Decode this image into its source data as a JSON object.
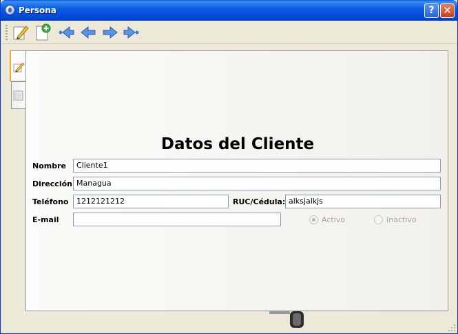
{
  "window": {
    "title": "Persona",
    "help_label": "?",
    "close_label": "✕"
  },
  "toolbar": {
    "icons": [
      "edit-icon",
      "new-record-icon",
      "first-record-icon",
      "previous-record-icon",
      "next-record-icon",
      "last-record-icon"
    ]
  },
  "tabs": [
    {
      "icon": "edit-icon",
      "active": true
    },
    {
      "icon": "list-icon",
      "active": false
    }
  ],
  "form": {
    "heading": "Datos del Cliente",
    "nombre_label": "Nombre",
    "nombre_value": "Cliente1",
    "direccion_label": "Dirección",
    "direccion_value": "Managua",
    "telefono_label": "Teléfono",
    "telefono_value": "1212121212",
    "ruc_label": "RUC/Cédula:",
    "ruc_value": "alksjalkjs",
    "email_label": "E-mail",
    "email_value": "",
    "status_options": [
      {
        "label": "Activo",
        "selected": true
      },
      {
        "label": "Inactivo",
        "selected": false
      }
    ]
  },
  "colors": {
    "titlebar": "#0046d5",
    "active_tab_accent": "#f8a52e",
    "field_border": "#7f9db9",
    "nav_arrow": "#3d7bd6"
  }
}
